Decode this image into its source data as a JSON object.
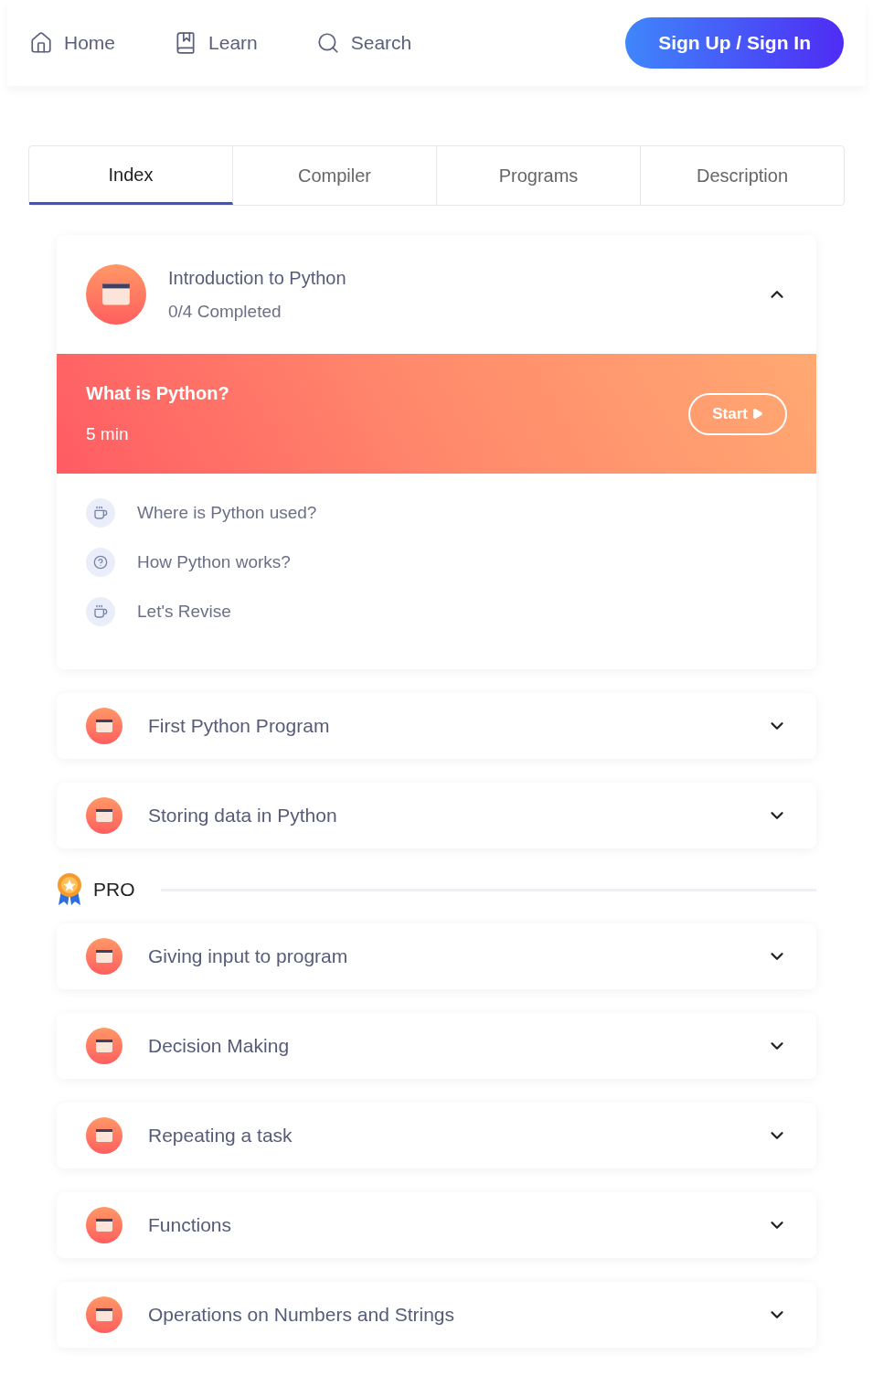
{
  "nav": {
    "items": [
      {
        "kind": "home",
        "label": "Home"
      },
      {
        "kind": "book",
        "label": "Learn"
      },
      {
        "kind": "search",
        "label": "Search"
      }
    ],
    "button": "Sign Up / Sign In"
  },
  "tabs": [
    {
      "label": "Index",
      "selected": true
    },
    {
      "label": "Compiler",
      "selected": false
    },
    {
      "label": "Programs",
      "selected": false
    },
    {
      "label": "Description",
      "selected": false
    }
  ],
  "chapters": [
    {
      "title": "Introduction to Python",
      "progress": "0/4 Completed",
      "expanded": true,
      "lessons": [
        {
          "title": "What is Python?",
          "duration": "5 min",
          "action": "Start",
          "selected": true
        },
        {
          "title": "Where is Python used?",
          "selected": false,
          "kind": "cup"
        },
        {
          "title": "How Python works?",
          "selected": false,
          "kind": "question"
        },
        {
          "title": "Let's Revise",
          "selected": false,
          "kind": "cup"
        }
      ]
    },
    {
      "title": "First Python Program",
      "expanded": false
    },
    {
      "title": "Storing data in Python",
      "expanded": false
    }
  ],
  "pro": {
    "label": "PRO",
    "chapters": [
      {
        "title": "Giving input to program",
        "expanded": false
      },
      {
        "title": "Decision Making",
        "expanded": false
      },
      {
        "title": "Repeating a task",
        "expanded": false
      },
      {
        "title": "Functions",
        "expanded": false
      },
      {
        "title": "Operations on Numbers and Strings",
        "expanded": false
      }
    ]
  }
}
